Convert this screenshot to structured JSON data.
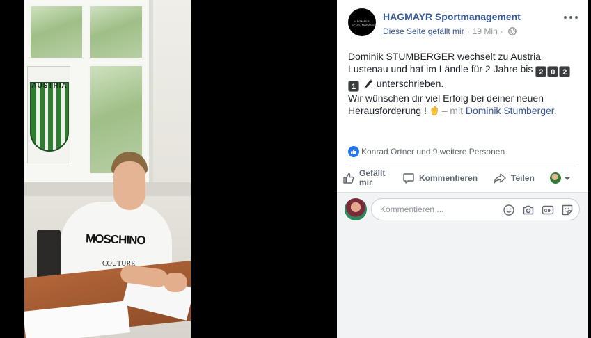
{
  "post": {
    "page_name": "HAGMAYR Sportmanagement",
    "page_logo_text": "HAGMAYR SPORTMANAGEMENT",
    "like_page_link": "Diese Seite gefällt mir",
    "separator": "·",
    "time": "19 Min",
    "separator2": "·",
    "text": {
      "line1": "Dominik STUMBERGER wechselt zu Austria",
      "line2_prefix": "Lustenau und hat im Ländle für 2 Jahre bis",
      "year_digits": [
        "2",
        "0",
        "2",
        "1"
      ],
      "line3_suffix": "unterschrieben.",
      "line4": "Wir wünschen dir viel Erfolg bei deiner neuen",
      "line5_prefix": "Herausforderung !",
      "with_prefix": "– mit",
      "tagged_user": "Dominik Stumberger",
      "tagged_suffix": "."
    },
    "reactions_text": "Konrad Ortner und 9 weitere Personen",
    "actions": {
      "like": "Gefällt mir",
      "comment": "Kommentieren",
      "share": "Teilen"
    },
    "comment_placeholder": "Kommentieren ..."
  },
  "photo": {
    "flag_text": "AUSTRIA",
    "shirt_text": "MOSCHINO",
    "shirt_subtext": "COUTURE"
  },
  "colors": {
    "link": "#365899",
    "meta": "#90949c",
    "text": "#1d2129",
    "comment_bg": "#f2f3f5"
  },
  "icons": {
    "more": "more-horizontal-icon",
    "globe": "globe-icon",
    "like_reaction": "like-reaction-icon",
    "like": "thumbs-up-icon",
    "comment": "comment-bubble-icon",
    "share": "share-arrow-icon",
    "emoji": "emoji-icon",
    "camera": "camera-icon",
    "gif": "gif-icon",
    "sticker": "sticker-icon"
  }
}
